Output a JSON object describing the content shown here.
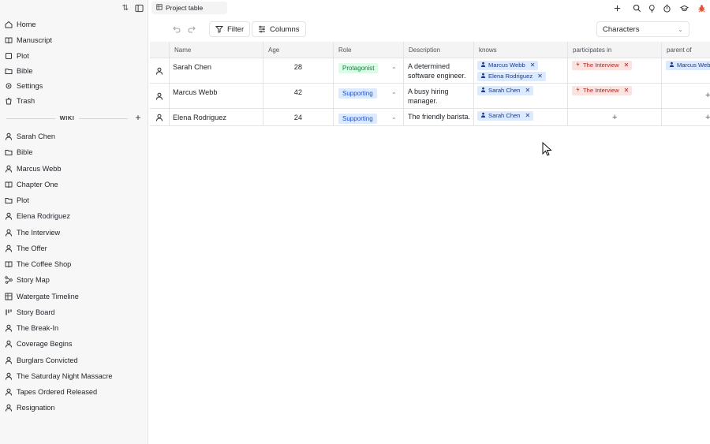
{
  "sidebar": {
    "top_items": [
      {
        "label": "Home",
        "icon": "home-icon"
      },
      {
        "label": "Manuscript",
        "icon": "book-icon"
      },
      {
        "label": "Plot",
        "icon": "square-icon"
      },
      {
        "label": "Bible",
        "icon": "folder-icon"
      },
      {
        "label": "Settings",
        "icon": "gear-icon"
      },
      {
        "label": "Trash",
        "icon": "trash-icon"
      }
    ],
    "wiki_label": "WIKI",
    "wiki_items": [
      {
        "label": "Sarah Chen",
        "icon": "person-icon"
      },
      {
        "label": "Bible",
        "icon": "folder-icon"
      },
      {
        "label": "Marcus Webb",
        "icon": "person-icon"
      },
      {
        "label": "Chapter One",
        "icon": "book-icon"
      },
      {
        "label": "Plot",
        "icon": "folder-icon"
      },
      {
        "label": "Elena Rodriguez",
        "icon": "person-icon"
      },
      {
        "label": "The Interview",
        "icon": "person-icon"
      },
      {
        "label": "The Offer",
        "icon": "person-icon"
      },
      {
        "label": "The Coffee Shop",
        "icon": "book-icon"
      },
      {
        "label": "Story Map",
        "icon": "network-icon"
      },
      {
        "label": "Watergate Timeline",
        "icon": "table-icon"
      },
      {
        "label": "Story Board",
        "icon": "board-icon"
      },
      {
        "label": "The Break-In",
        "icon": "person-icon"
      },
      {
        "label": "Coverage Begins",
        "icon": "person-icon"
      },
      {
        "label": "Burglars Convicted",
        "icon": "person-icon"
      },
      {
        "label": "The Saturday Night Massacre",
        "icon": "person-icon"
      },
      {
        "label": "Tapes Ordered Released",
        "icon": "person-icon"
      },
      {
        "label": "Resignation",
        "icon": "person-icon"
      }
    ]
  },
  "topbar": {
    "tab_label": "Project table"
  },
  "toolbar": {
    "filter_label": "Filter",
    "columns_label": "Columns",
    "table_select_value": "Characters"
  },
  "table": {
    "headers": [
      "Name",
      "Age",
      "Role",
      "Description",
      "knows",
      "participates in",
      "parent of"
    ],
    "rows": [
      {
        "name": "Sarah Chen",
        "age": "28",
        "role": "Protagonist",
        "desc1": "A determined",
        "desc2": "software engineer.",
        "knows": [
          "Marcus Webb",
          "Elena Rodriguez"
        ],
        "participates": [
          "The Interview"
        ],
        "parent_of": [
          "Marcus Webb"
        ]
      },
      {
        "name": "Marcus Webb",
        "age": "42",
        "role": "Supporting",
        "desc1": "A busy hiring",
        "desc2": "manager.",
        "knows": [
          "Sarah Chen"
        ],
        "participates": [
          "The Interview"
        ],
        "parent_of": []
      },
      {
        "name": "Elena Rodriguez",
        "age": "24",
        "role": "Supporting",
        "desc1": "The friendly barista.",
        "desc2": "",
        "knows": [
          "Sarah Chen"
        ],
        "participates": [],
        "parent_of": []
      }
    ]
  },
  "colors": {
    "protagonist_bg": "#dcfce7",
    "supporting_bg": "#dbeafe",
    "event_chip_bg": "#fde2e2",
    "person_chip_bg": "#dbeafe",
    "bug_icon_color": "#e0553a"
  }
}
